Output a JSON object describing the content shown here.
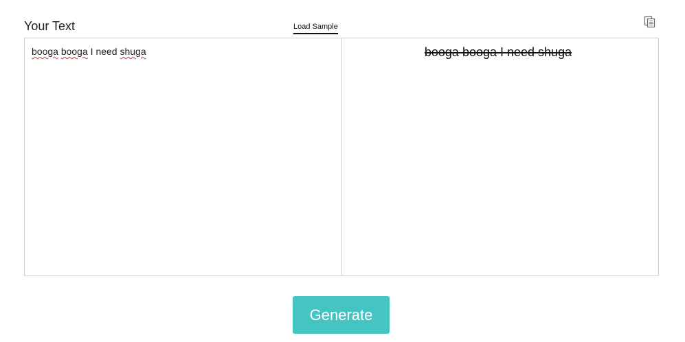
{
  "input_panel": {
    "title": "Your Text",
    "load_sample_label": "Load Sample",
    "words": [
      "booga",
      "booga",
      "I",
      "need",
      "shuga"
    ],
    "misspelled": [
      true,
      true,
      false,
      false,
      true
    ]
  },
  "output_panel": {
    "text": "booga booga I need shuga"
  },
  "toolbar": {
    "copy_icon": "copy-icon"
  },
  "actions": {
    "generate_label": "Generate"
  },
  "colors": {
    "accent": "#45c4c4",
    "spellcheck": "#d23b3b",
    "border": "#cfcfcf"
  }
}
